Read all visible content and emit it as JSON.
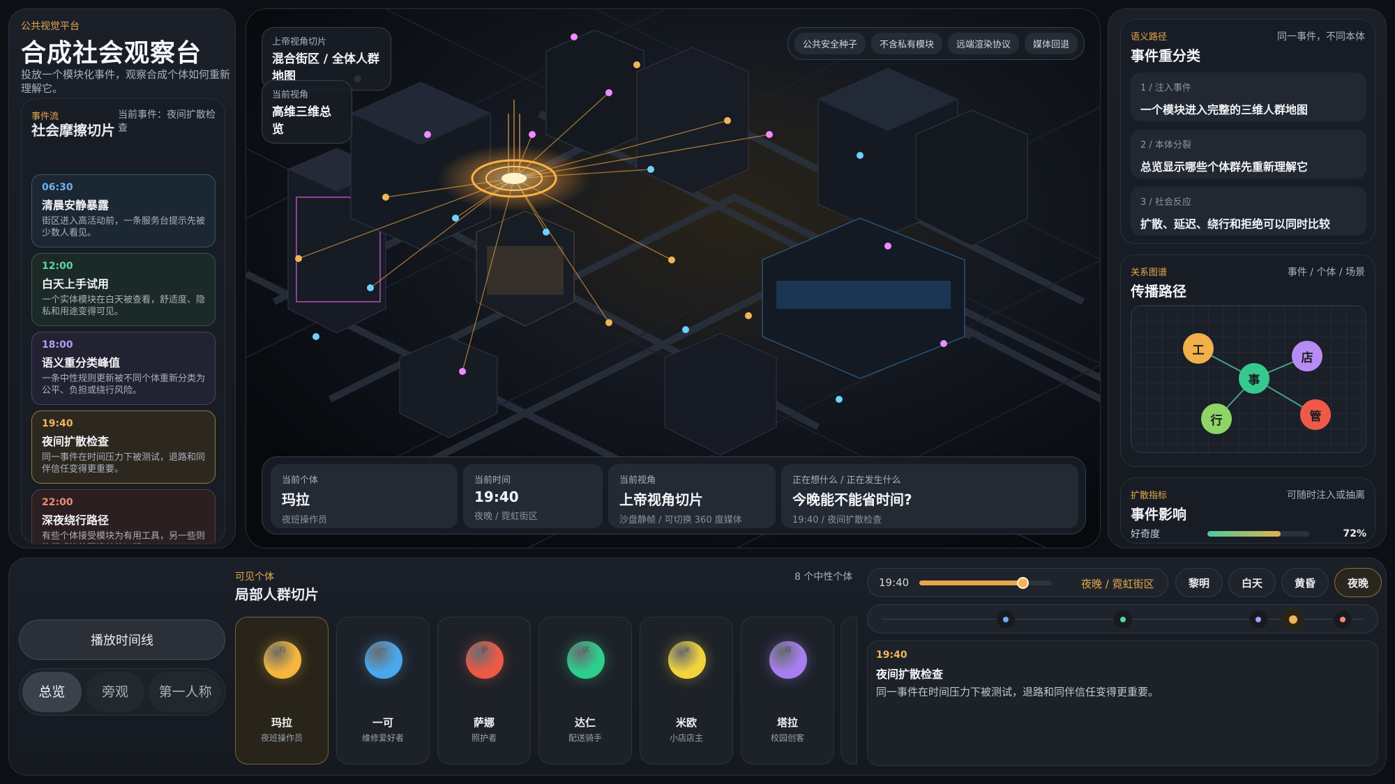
{
  "brand": {
    "tag": "公共视觉平台",
    "title": "合成社会观察台",
    "description": "投放一个模块化事件，观察合成个体如何重新理解它。"
  },
  "event_flow": {
    "tag": "事件流",
    "title": "社会摩擦切片",
    "current": "当前事件：夜间扩散检查",
    "events": [
      {
        "time": "06:30",
        "name": "清晨安静暴露",
        "desc": "街区进入高活动前，一条服务台提示先被少数人看见。",
        "style": "blue"
      },
      {
        "time": "12:00",
        "name": "白天上手试用",
        "desc": "一个实体模块在白天被查看，舒适度、隐私和用途变得可见。",
        "style": "green"
      },
      {
        "time": "18:00",
        "name": "语义重分类峰值",
        "desc": "一条中性规则更新被不同个体重新分类为公平、负担或绕行风险。",
        "style": "purple"
      },
      {
        "time": "19:40",
        "name": "夜间扩散检查",
        "desc": "同一事件在时间压力下被测试，退路和同伴信任变得更重要。",
        "style": "gold"
      },
      {
        "time": "22:00",
        "name": "深夜绕行路径",
        "desc": "有些个体接受模块为有用工具，另一些则绕行或等待更清楚的证明。",
        "style": "red"
      }
    ]
  },
  "scene": {
    "slice_label": "上帝视角切片",
    "slice_value": "混合街区 / 全体人群地图",
    "view_label": "当前视角",
    "view_value": "高维三维总览",
    "toolbar": [
      "公共安全种子",
      "不含私有模块",
      "远端渲染协议",
      "媒体回退"
    ],
    "status": [
      {
        "label": "当前个体",
        "value": "玛拉",
        "sub": "夜班操作员"
      },
      {
        "label": "当前时间",
        "value": "19:40",
        "sub": "夜晚 / 霓虹街区"
      },
      {
        "label": "当前视角",
        "value": "上帝视角切片",
        "sub": "沙盘静帧 / 可切换 360 度媒体"
      },
      {
        "label": "正在想什么 / 正在发生什么",
        "value": "今晚能不能省时间?",
        "sub": "19:40 / 夜间扩散检查"
      }
    ]
  },
  "semantic": {
    "tag": "语义路径",
    "title": "事件重分类",
    "right": "同一事件，不同本体",
    "steps": [
      {
        "label": "1 / 注入事件",
        "text": "一个模块进入完整的三维人群地图"
      },
      {
        "label": "2 / 本体分裂",
        "text": "总览显示哪些个体群先重新理解它"
      },
      {
        "label": "3 / 社会反应",
        "text": "扩散、延迟、绕行和拒绝可以同时比较"
      }
    ]
  },
  "graph": {
    "tag": "关系图谱",
    "title": "传播路径",
    "right": "事件 / 个体 / 场景",
    "nodes": {
      "center": "事",
      "tl": "工",
      "tr": "店",
      "bl": "行",
      "br": "管"
    }
  },
  "impact": {
    "tag": "扩散指标",
    "title": "事件影响",
    "right": "可随时注入或抽离",
    "metric": {
      "label": "好奇度",
      "value": "72%",
      "fraction": 0.72
    }
  },
  "controls": {
    "play": "播放时间线",
    "views": [
      "总览",
      "旁观",
      "第一人称"
    ]
  },
  "crowd": {
    "tag": "可见个体",
    "title": "局部人群切片",
    "count": "8 个中性个体",
    "people": [
      {
        "name": "玛拉",
        "role": "夜班操作员",
        "glyph": "玛",
        "color": "#f4b63f"
      },
      {
        "name": "一可",
        "role": "维修爱好者",
        "glyph": "一",
        "color": "#4aa8ec"
      },
      {
        "name": "萨娜",
        "role": "照护者",
        "glyph": "萨",
        "color": "#ec5a45"
      },
      {
        "name": "达仁",
        "role": "配送骑手",
        "glyph": "达",
        "color": "#2ccf8c"
      },
      {
        "name": "米欧",
        "role": "小店店主",
        "glyph": "米",
        "color": "#f2d43c"
      },
      {
        "name": "塔拉",
        "role": "校园创客",
        "glyph": "塔",
        "color": "#a77ff0"
      }
    ]
  },
  "timeline": {
    "time": "19:40",
    "scene": "夜晚 / 霓虹街区",
    "progress": 0.78,
    "periods": [
      "黎明",
      "白天",
      "黄昏",
      "夜晚"
    ],
    "active_period": "夜晚",
    "detail": {
      "time": "19:40",
      "name": "夜间扩散检查",
      "desc": "同一事件在时间压力下被测试，退路和同伴信任变得更重要。"
    }
  }
}
